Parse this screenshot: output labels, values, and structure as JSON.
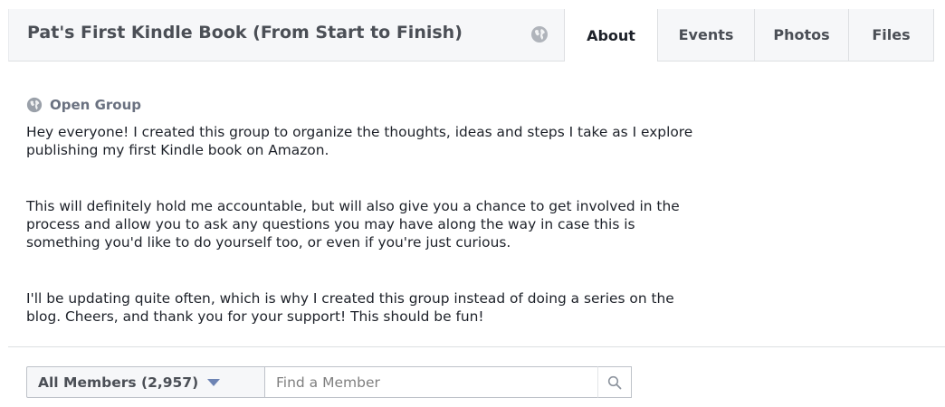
{
  "header": {
    "group_title": "Pat's First Kindle Book (From Start to Finish)",
    "title_icon": "globe-icon",
    "tabs": [
      {
        "label": "About",
        "active": true
      },
      {
        "label": "Events",
        "active": false
      },
      {
        "label": "Photos",
        "active": false
      },
      {
        "label": "Files",
        "active": false
      }
    ]
  },
  "about": {
    "privacy_icon": "globe-icon",
    "privacy_label": "Open Group",
    "paragraphs": [
      {
        "lines": [
          "Hey everyone! I created this group to organize the thoughts, ideas and steps I take as I explore",
          "publishing my first Kindle book on Amazon."
        ]
      },
      {
        "lines": [
          "This will definitely hold me accountable, but will also give you a chance to get involved in the",
          "process and allow you to ask any questions you may have along the way in case this is",
          "something you'd like to do yourself too, or even if you're just curious."
        ]
      },
      {
        "lines": [
          "I'll be updating quite often, which is why I created this group instead of doing a series on the",
          "blog. Cheers, and thank you for your support! This should be fun!"
        ]
      }
    ]
  },
  "members": {
    "filter_label": "All Members (2,957)",
    "search_placeholder": "Find a Member",
    "search_value": "",
    "search_icon": "search-icon"
  },
  "colors": {
    "header_bg": "#f6f7f9",
    "border": "#dddfe2",
    "caret_blue": "#6d84b4",
    "muted_text": "#6a7180"
  }
}
